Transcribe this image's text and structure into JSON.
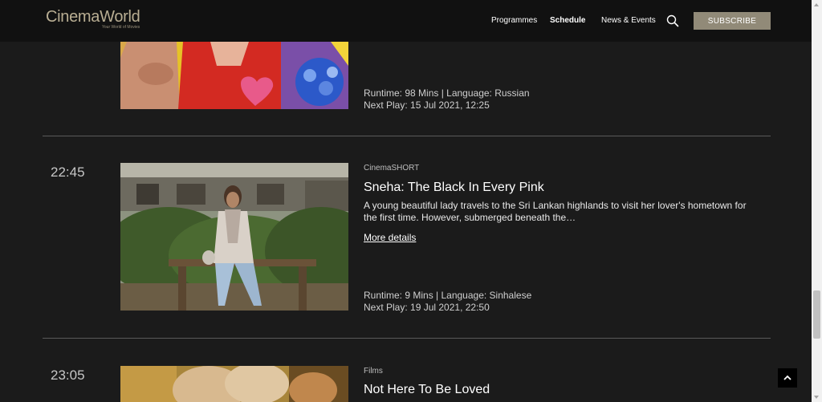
{
  "header": {
    "logo": "CinemaWorld",
    "tagline": "Your World of Movies",
    "nav": [
      "Programmes",
      "Schedule",
      "News & Events"
    ],
    "subscribe_label": "SUBSCRIBE"
  },
  "colors": {
    "accent": "#918a78",
    "logo": "#b9ae93",
    "background": "#1b1b1b",
    "header": "#111111"
  },
  "schedule": [
    {
      "runtime_line": "Runtime: 98 Mins | Language: Russian",
      "next_play": "Next Play: 15 Jul 2021, 12:25"
    },
    {
      "time": "22:45",
      "category": "CinemaSHORT",
      "title": "Sneha: The Black In Every Pink",
      "description": "A young beautiful lady travels to the Sri Lankan highlands to visit her lover's hometown for the first time. However, submerged beneath the…",
      "more_label": "More details",
      "runtime_line": "Runtime: 9 Mins | Language: Sinhalese",
      "next_play": "Next Play: 19 Jul 2021, 22:50"
    },
    {
      "time": "23:05",
      "category": "Films",
      "title": "Not Here To Be Loved"
    }
  ],
  "icons": {
    "search": "search-icon",
    "back_to_top": "chevron-up-icon"
  }
}
